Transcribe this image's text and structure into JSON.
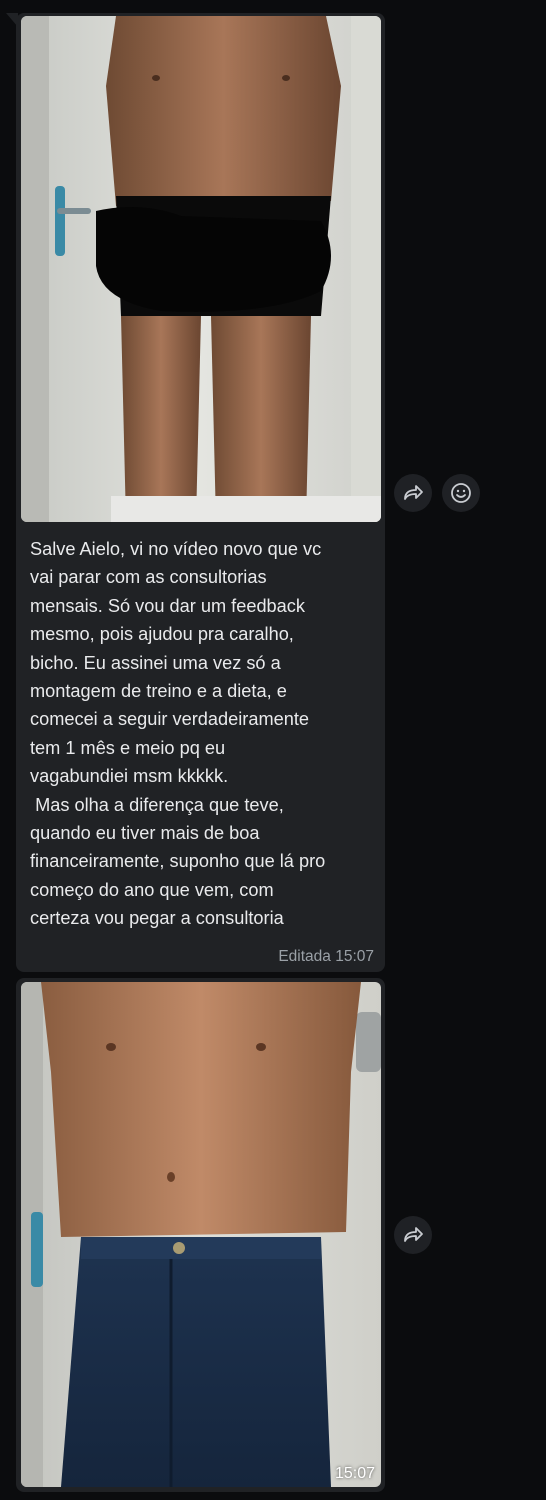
{
  "messages": [
    {
      "type": "photo_caption",
      "image_icon": "photo-shirtless-torso-icon",
      "caption": "Salve Aielo, vi no vídeo novo que vc\nvai parar com as consultorias\nmensais. Só vou dar um feedback\nmesmo, pois ajudou pra caralho,\nbicho. Eu assinei uma vez só a\nmontagem de treino e a dieta, e\ncomecei a seguir verdadeiramente\ntem 1 mês e meio pq eu\nvagabundiei msm kkkkk.\n Mas olha a diferença que teve,\nquando eu tiver mais de boa\nfinanceiramente, suponho que lá pro\ncomeço do ano que vem, com\ncerteza vou pegar a consultoria",
      "meta": "Editada 15:07",
      "actions": [
        "forward-icon",
        "emoji-reaction-icon"
      ]
    },
    {
      "type": "photo",
      "image_icon": "photo-torso-jeans-icon",
      "meta": "15:07",
      "actions": [
        "forward-icon"
      ]
    }
  ],
  "colors": {
    "background": "#0b0c0e",
    "bubble": "#202225",
    "text": "#e9eaec",
    "meta": "#9aa0a6"
  }
}
